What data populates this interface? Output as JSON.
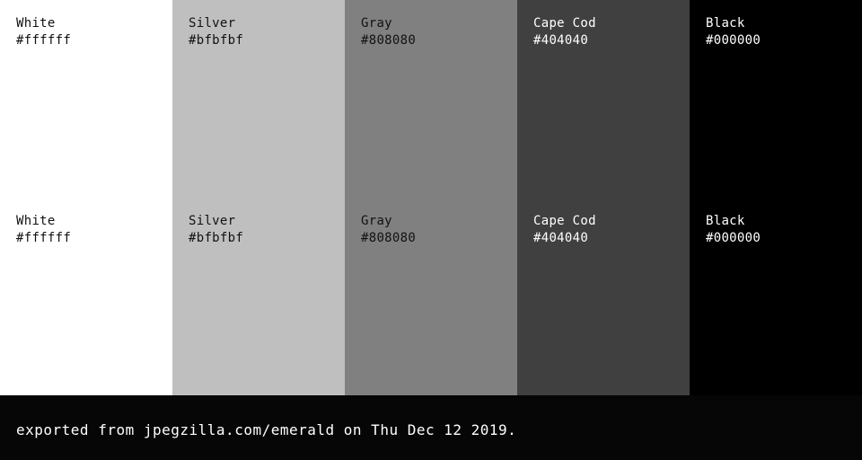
{
  "palette": {
    "rows": [
      {
        "swatches": [
          {
            "name": "White",
            "hex": "#ffffff",
            "color": "#ffffff",
            "text_color": "#111111"
          },
          {
            "name": "Silver",
            "hex": "#bfbfbf",
            "color": "#bfbfbf",
            "text_color": "#111111"
          },
          {
            "name": "Gray",
            "hex": "#808080",
            "color": "#808080",
            "text_color": "#111111"
          },
          {
            "name": "Cape Cod",
            "hex": "#404040",
            "color": "#404040",
            "text_color": "#ffffff"
          },
          {
            "name": "Black",
            "hex": "#000000",
            "color": "#000000",
            "text_color": "#ffffff"
          }
        ]
      },
      {
        "swatches": [
          {
            "name": "White",
            "hex": "#ffffff",
            "color": "#ffffff",
            "text_color": "#111111"
          },
          {
            "name": "Silver",
            "hex": "#bfbfbf",
            "color": "#bfbfbf",
            "text_color": "#111111"
          },
          {
            "name": "Gray",
            "hex": "#808080",
            "color": "#808080",
            "text_color": "#111111"
          },
          {
            "name": "Cape Cod",
            "hex": "#404040",
            "color": "#404040",
            "text_color": "#ffffff"
          },
          {
            "name": "Black",
            "hex": "#000000",
            "color": "#000000",
            "text_color": "#ffffff"
          }
        ]
      }
    ]
  },
  "footer": {
    "text": "exported from jpegzilla.com/emerald on Thu Dec 12 2019."
  },
  "colors": {
    "footer_background": "#060606"
  }
}
